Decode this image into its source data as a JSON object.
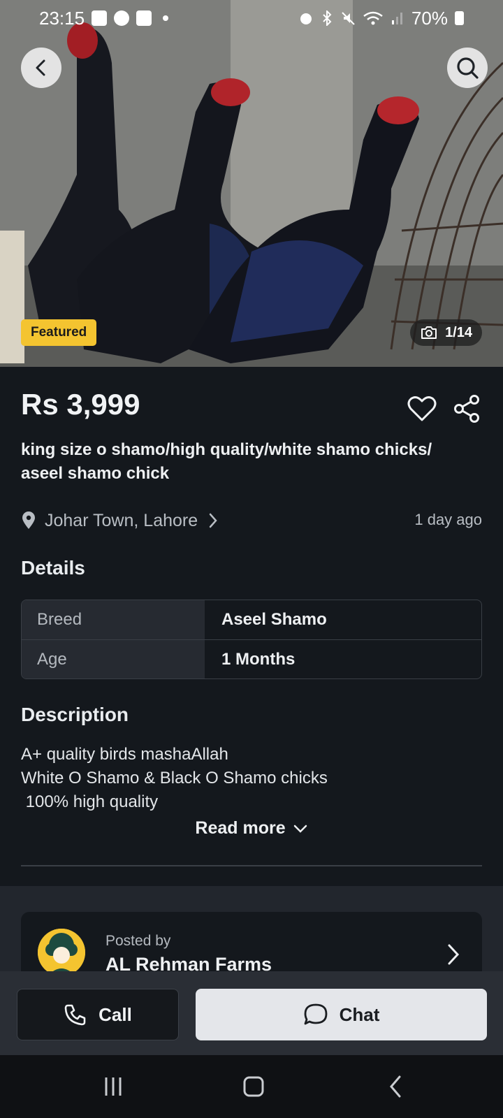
{
  "status_bar": {
    "time": "23:15",
    "left_icons": [
      "gallery-icon",
      "facebook-icon",
      "youtube-icon",
      "dot-icon"
    ],
    "right_icons": [
      "alarm-icon",
      "bluetooth-icon",
      "mute-icon",
      "wifi-icon",
      "signal-icon",
      "battery-icon"
    ],
    "battery": "70%"
  },
  "hero": {
    "badge": "Featured",
    "image_counter": "1/14",
    "back_icon": "chevron-left-icon",
    "search_icon": "search-icon"
  },
  "listing": {
    "price": "Rs 3,999",
    "title": "king size o shamo/high quality/white shamo chicks/ aseel shamo chick",
    "location": "Johar Town, Lahore",
    "posted_ago": "1 day ago"
  },
  "details": {
    "heading": "Details",
    "rows": [
      {
        "key": "Breed",
        "value": "Aseel Shamo"
      },
      {
        "key": "Age",
        "value": "1 Months"
      }
    ]
  },
  "description": {
    "heading": "Description",
    "lines": [
      "A+ quality birds mashaAllah",
      "White O Shamo & Black O Shamo chicks",
      " 100% high quality"
    ],
    "read_more": "Read more"
  },
  "poster": {
    "label": "Posted by",
    "name": "AL Rehman Farms"
  },
  "actions": {
    "call": "Call",
    "chat": "Chat"
  },
  "colors": {
    "background": "#14181d",
    "featured_badge": "#f4c430",
    "action_bar": "#2a2e35",
    "chat_button": "#e4e6ea"
  }
}
